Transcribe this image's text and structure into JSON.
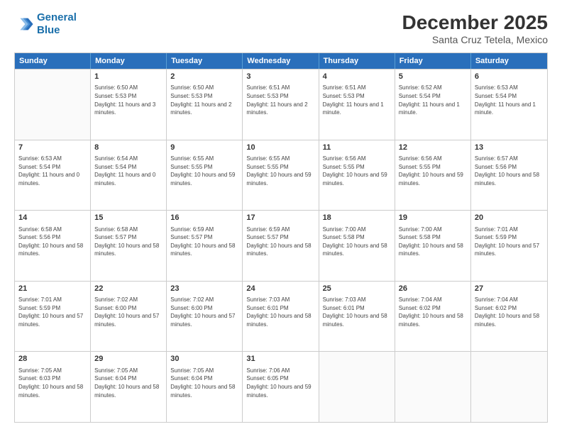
{
  "logo": {
    "line1": "General",
    "line2": "Blue"
  },
  "title": "December 2025",
  "subtitle": "Santa Cruz Tetela, Mexico",
  "header_days": [
    "Sunday",
    "Monday",
    "Tuesday",
    "Wednesday",
    "Thursday",
    "Friday",
    "Saturday"
  ],
  "weeks": [
    [
      {
        "day": "",
        "sunrise": "",
        "sunset": "",
        "daylight": ""
      },
      {
        "day": "1",
        "sunrise": "Sunrise: 6:50 AM",
        "sunset": "Sunset: 5:53 PM",
        "daylight": "Daylight: 11 hours and 3 minutes."
      },
      {
        "day": "2",
        "sunrise": "Sunrise: 6:50 AM",
        "sunset": "Sunset: 5:53 PM",
        "daylight": "Daylight: 11 hours and 2 minutes."
      },
      {
        "day": "3",
        "sunrise": "Sunrise: 6:51 AM",
        "sunset": "Sunset: 5:53 PM",
        "daylight": "Daylight: 11 hours and 2 minutes."
      },
      {
        "day": "4",
        "sunrise": "Sunrise: 6:51 AM",
        "sunset": "Sunset: 5:53 PM",
        "daylight": "Daylight: 11 hours and 1 minute."
      },
      {
        "day": "5",
        "sunrise": "Sunrise: 6:52 AM",
        "sunset": "Sunset: 5:54 PM",
        "daylight": "Daylight: 11 hours and 1 minute."
      },
      {
        "day": "6",
        "sunrise": "Sunrise: 6:53 AM",
        "sunset": "Sunset: 5:54 PM",
        "daylight": "Daylight: 11 hours and 1 minute."
      }
    ],
    [
      {
        "day": "7",
        "sunrise": "Sunrise: 6:53 AM",
        "sunset": "Sunset: 5:54 PM",
        "daylight": "Daylight: 11 hours and 0 minutes."
      },
      {
        "day": "8",
        "sunrise": "Sunrise: 6:54 AM",
        "sunset": "Sunset: 5:54 PM",
        "daylight": "Daylight: 11 hours and 0 minutes."
      },
      {
        "day": "9",
        "sunrise": "Sunrise: 6:55 AM",
        "sunset": "Sunset: 5:55 PM",
        "daylight": "Daylight: 10 hours and 59 minutes."
      },
      {
        "day": "10",
        "sunrise": "Sunrise: 6:55 AM",
        "sunset": "Sunset: 5:55 PM",
        "daylight": "Daylight: 10 hours and 59 minutes."
      },
      {
        "day": "11",
        "sunrise": "Sunrise: 6:56 AM",
        "sunset": "Sunset: 5:55 PM",
        "daylight": "Daylight: 10 hours and 59 minutes."
      },
      {
        "day": "12",
        "sunrise": "Sunrise: 6:56 AM",
        "sunset": "Sunset: 5:55 PM",
        "daylight": "Daylight: 10 hours and 59 minutes."
      },
      {
        "day": "13",
        "sunrise": "Sunrise: 6:57 AM",
        "sunset": "Sunset: 5:56 PM",
        "daylight": "Daylight: 10 hours and 58 minutes."
      }
    ],
    [
      {
        "day": "14",
        "sunrise": "Sunrise: 6:58 AM",
        "sunset": "Sunset: 5:56 PM",
        "daylight": "Daylight: 10 hours and 58 minutes."
      },
      {
        "day": "15",
        "sunrise": "Sunrise: 6:58 AM",
        "sunset": "Sunset: 5:57 PM",
        "daylight": "Daylight: 10 hours and 58 minutes."
      },
      {
        "day": "16",
        "sunrise": "Sunrise: 6:59 AM",
        "sunset": "Sunset: 5:57 PM",
        "daylight": "Daylight: 10 hours and 58 minutes."
      },
      {
        "day": "17",
        "sunrise": "Sunrise: 6:59 AM",
        "sunset": "Sunset: 5:57 PM",
        "daylight": "Daylight: 10 hours and 58 minutes."
      },
      {
        "day": "18",
        "sunrise": "Sunrise: 7:00 AM",
        "sunset": "Sunset: 5:58 PM",
        "daylight": "Daylight: 10 hours and 58 minutes."
      },
      {
        "day": "19",
        "sunrise": "Sunrise: 7:00 AM",
        "sunset": "Sunset: 5:58 PM",
        "daylight": "Daylight: 10 hours and 58 minutes."
      },
      {
        "day": "20",
        "sunrise": "Sunrise: 7:01 AM",
        "sunset": "Sunset: 5:59 PM",
        "daylight": "Daylight: 10 hours and 57 minutes."
      }
    ],
    [
      {
        "day": "21",
        "sunrise": "Sunrise: 7:01 AM",
        "sunset": "Sunset: 5:59 PM",
        "daylight": "Daylight: 10 hours and 57 minutes."
      },
      {
        "day": "22",
        "sunrise": "Sunrise: 7:02 AM",
        "sunset": "Sunset: 6:00 PM",
        "daylight": "Daylight: 10 hours and 57 minutes."
      },
      {
        "day": "23",
        "sunrise": "Sunrise: 7:02 AM",
        "sunset": "Sunset: 6:00 PM",
        "daylight": "Daylight: 10 hours and 57 minutes."
      },
      {
        "day": "24",
        "sunrise": "Sunrise: 7:03 AM",
        "sunset": "Sunset: 6:01 PM",
        "daylight": "Daylight: 10 hours and 58 minutes."
      },
      {
        "day": "25",
        "sunrise": "Sunrise: 7:03 AM",
        "sunset": "Sunset: 6:01 PM",
        "daylight": "Daylight: 10 hours and 58 minutes."
      },
      {
        "day": "26",
        "sunrise": "Sunrise: 7:04 AM",
        "sunset": "Sunset: 6:02 PM",
        "daylight": "Daylight: 10 hours and 58 minutes."
      },
      {
        "day": "27",
        "sunrise": "Sunrise: 7:04 AM",
        "sunset": "Sunset: 6:02 PM",
        "daylight": "Daylight: 10 hours and 58 minutes."
      }
    ],
    [
      {
        "day": "28",
        "sunrise": "Sunrise: 7:05 AM",
        "sunset": "Sunset: 6:03 PM",
        "daylight": "Daylight: 10 hours and 58 minutes."
      },
      {
        "day": "29",
        "sunrise": "Sunrise: 7:05 AM",
        "sunset": "Sunset: 6:04 PM",
        "daylight": "Daylight: 10 hours and 58 minutes."
      },
      {
        "day": "30",
        "sunrise": "Sunrise: 7:05 AM",
        "sunset": "Sunset: 6:04 PM",
        "daylight": "Daylight: 10 hours and 58 minutes."
      },
      {
        "day": "31",
        "sunrise": "Sunrise: 7:06 AM",
        "sunset": "Sunset: 6:05 PM",
        "daylight": "Daylight: 10 hours and 59 minutes."
      },
      {
        "day": "",
        "sunrise": "",
        "sunset": "",
        "daylight": ""
      },
      {
        "day": "",
        "sunrise": "",
        "sunset": "",
        "daylight": ""
      },
      {
        "day": "",
        "sunrise": "",
        "sunset": "",
        "daylight": ""
      }
    ]
  ]
}
